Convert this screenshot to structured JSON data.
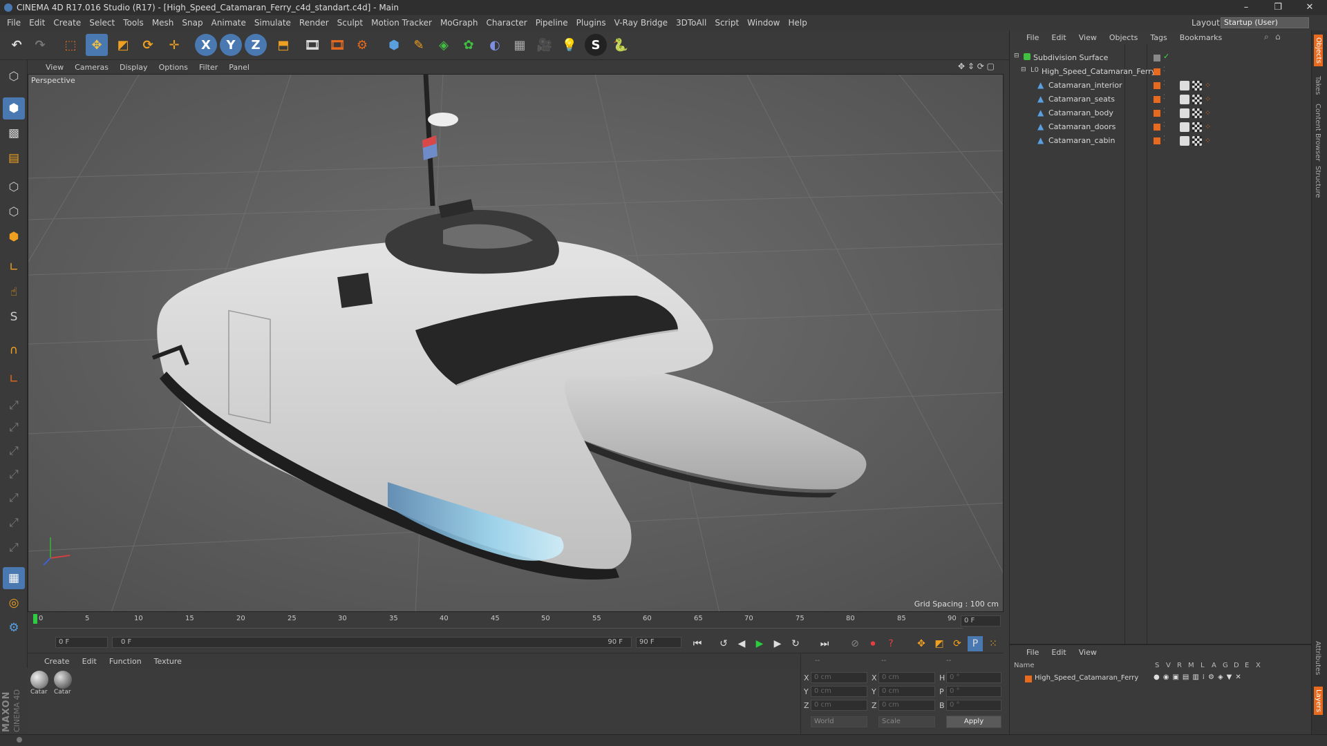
{
  "window": {
    "title": "CINEMA 4D R17.016 Studio (R17) - [High_Speed_Catamaran_Ferry_c4d_standart.c4d] - Main",
    "controls": [
      "–",
      "❐",
      "✕"
    ]
  },
  "menu": [
    "File",
    "Edit",
    "Create",
    "Select",
    "Tools",
    "Mesh",
    "Snap",
    "Animate",
    "Simulate",
    "Render",
    "Sculpt",
    "Motion Tracker",
    "MoGraph",
    "Character",
    "Pipeline",
    "Plugins",
    "V-Ray Bridge",
    "3DToAll",
    "Script",
    "Window",
    "Help"
  ],
  "layout": {
    "label": "Layout:",
    "value": "Startup (User)"
  },
  "toolbar": {
    "axis_x": "X",
    "axis_y": "Y",
    "axis_z": "Z",
    "icons": [
      "undo-icon",
      "redo-icon",
      "live-selection-icon",
      "move-icon",
      "scale-icon",
      "rotate-icon",
      "last-tool-icon",
      "x-axis-lock",
      "y-axis-lock",
      "z-axis-lock",
      "coordinate-system-icon",
      "render-view-icon",
      "render-picture-viewer-icon",
      "edit-render-settings-icon",
      "cube-primitive-icon",
      "pen-spline-icon",
      "subdivision-surface-icon",
      "cloner-icon",
      "deformer-icon",
      "floor-icon",
      "camera-icon",
      "light-icon",
      "vray-icon",
      "python-icon"
    ]
  },
  "viewport": {
    "menu": [
      "View",
      "Cameras",
      "Display",
      "Options",
      "Filter",
      "Panel"
    ],
    "label": "Perspective",
    "grid_spacing": "Grid Spacing : 100 cm"
  },
  "timeline": {
    "ticks": [
      "0",
      "5",
      "10",
      "15",
      "20",
      "25",
      "30",
      "35",
      "40",
      "45",
      "50",
      "55",
      "60",
      "65",
      "70",
      "75",
      "80",
      "85",
      "90"
    ],
    "current_frame": "0 F",
    "start_field": "0 F",
    "range_start": "0 F",
    "range_end": "90 F",
    "end_field": "90 F"
  },
  "materials": {
    "menu": [
      "Create",
      "Edit",
      "Function",
      "Texture"
    ],
    "items": [
      "Catar",
      "Catar"
    ]
  },
  "coordinates": {
    "header": [
      "--",
      "--",
      "--"
    ],
    "rows": [
      {
        "pos_label": "X",
        "pos": "0 cm",
        "size_label": "X",
        "size": "0 cm",
        "rot_label": "H",
        "rot": "0 °"
      },
      {
        "pos_label": "Y",
        "pos": "0 cm",
        "size_label": "Y",
        "size": "0 cm",
        "rot_label": "P",
        "rot": "0 °"
      },
      {
        "pos_label": "Z",
        "pos": "0 cm",
        "size_label": "Z",
        "size": "0 cm",
        "rot_label": "B",
        "rot": "0 °"
      }
    ],
    "mode": "World",
    "transform": "Scale",
    "apply": "Apply"
  },
  "objects": {
    "menu": [
      "File",
      "Edit",
      "View",
      "Objects",
      "Tags",
      "Bookmarks"
    ],
    "tree": [
      {
        "name": "Subdivision Surface",
        "level": 0
      },
      {
        "name": "High_Speed_Catamaran_Ferry",
        "level": 1
      },
      {
        "name": "Catamaran_interior",
        "level": 2
      },
      {
        "name": "Catamaran_seats",
        "level": 2
      },
      {
        "name": "Catamaran_body",
        "level": 2
      },
      {
        "name": "Catamaran_doors",
        "level": 2
      },
      {
        "name": "Catamaran_cabin",
        "level": 2
      }
    ]
  },
  "layers": {
    "menu": [
      "File",
      "Edit",
      "View"
    ],
    "columns": [
      "Name",
      "S",
      "V",
      "R",
      "M",
      "L",
      "A",
      "G",
      "D",
      "E",
      "X"
    ],
    "rows": [
      {
        "name": "High_Speed_Catamaran_Ferry"
      }
    ]
  },
  "side_tabs": [
    "Objects",
    "Takes",
    "Content Browser",
    "Structure",
    "Attributes",
    "Layers"
  ],
  "branding": {
    "maxon": "MAXON",
    "cinema": "CINEMA 4D"
  },
  "colors": {
    "accent_orange": "#e86a1e",
    "tool_blue": "#4a78b0",
    "viewport_bg": "#5e5e5e"
  }
}
